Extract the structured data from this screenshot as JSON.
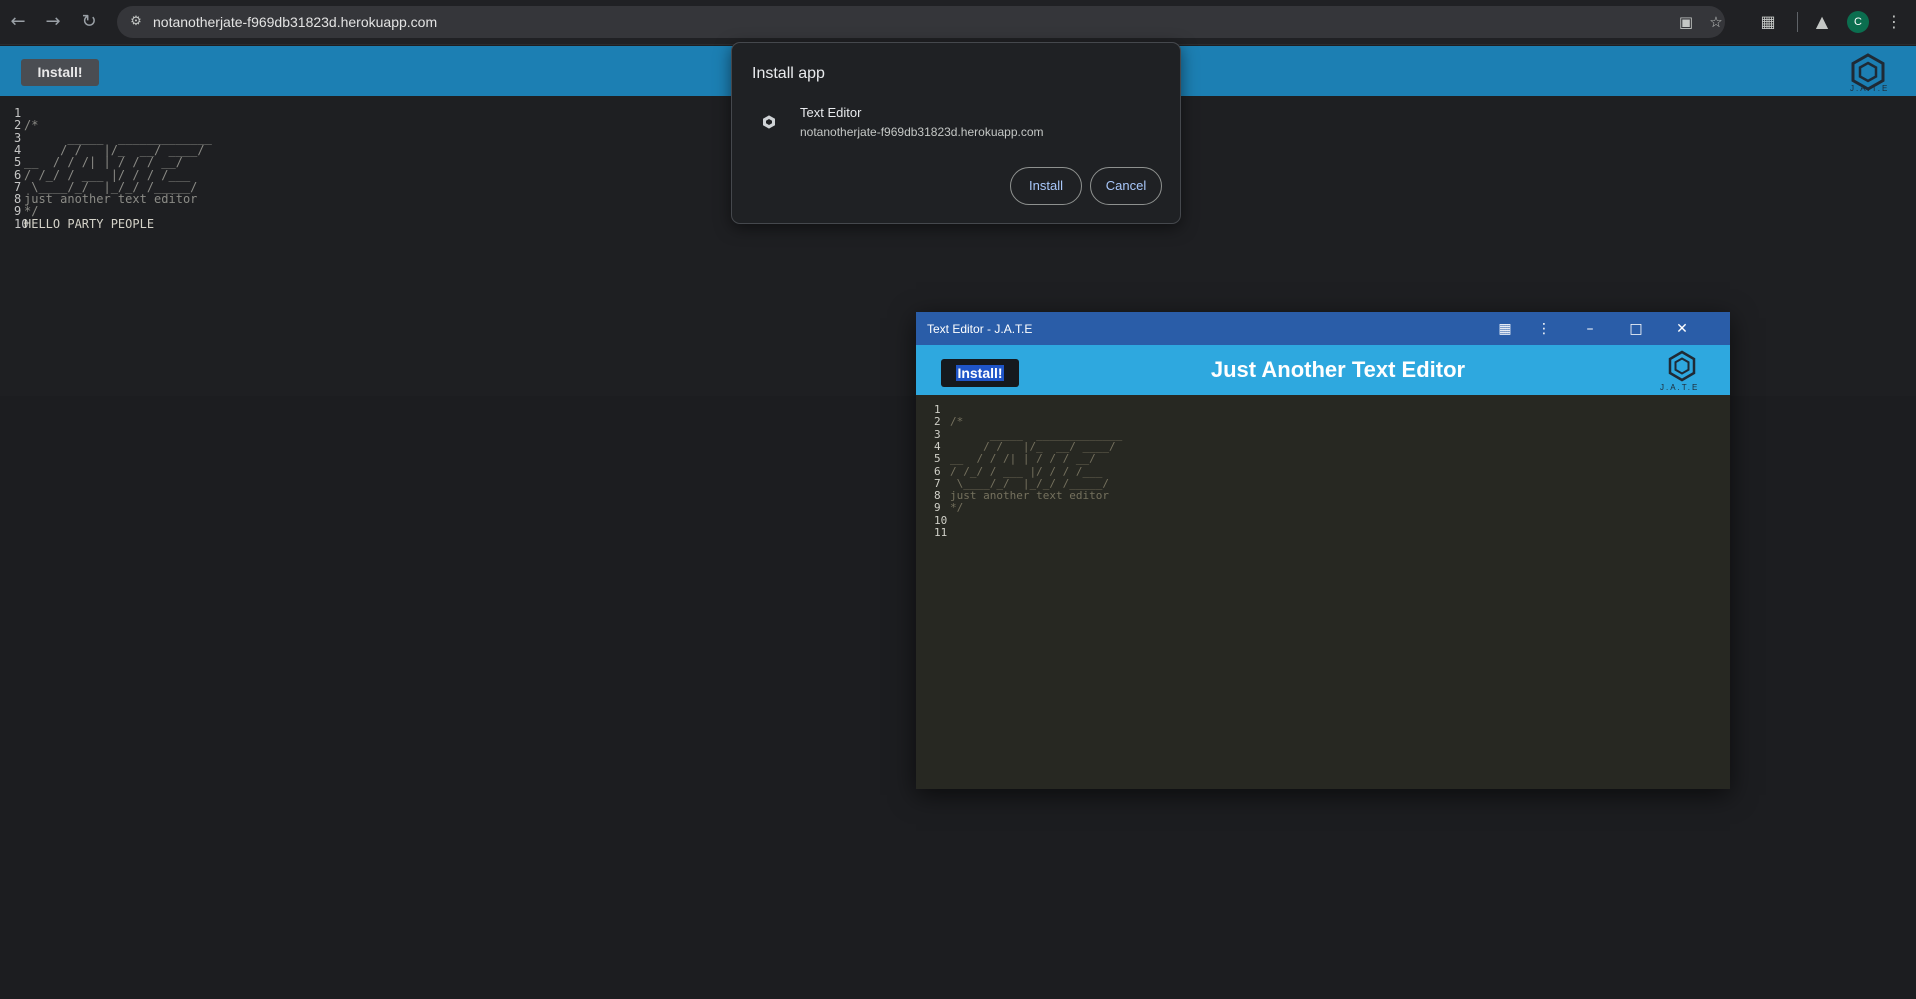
{
  "browser": {
    "url": "notanotherjate-f969db31823d.herokuapp.com",
    "profile_initial": "C",
    "icons": {
      "back": "back-arrow-icon",
      "forward": "forward-arrow-icon",
      "reload": "reload-icon",
      "site_info": "tune-icon",
      "install_app": "install-desktop-icon",
      "bookmark": "star-icon",
      "extensions": "puzzle-icon",
      "labs": "flask-icon",
      "menu": "kebab-menu-icon"
    }
  },
  "page": {
    "install_label": "Install!",
    "logo_text": "J.A.T.E",
    "header_color": "#1c7fb3",
    "editor_lines": [
      {
        "n": "1",
        "text": ""
      },
      {
        "n": "2",
        "text": "/*"
      },
      {
        "n": "3",
        "text": "      _____  _____________"
      },
      {
        "n": "4",
        "text": "     / /   |/_  __/ ____/"
      },
      {
        "n": "5",
        "text": "__  / / /| | / / / __/"
      },
      {
        "n": "6",
        "text": "/ /_/ / ___ |/ / / /___"
      },
      {
        "n": "7",
        "text": " \\____/_/  |_/_/ /_____/"
      },
      {
        "n": "8",
        "text": "just another text editor"
      },
      {
        "n": "9",
        "text": "*/"
      },
      {
        "n": "10",
        "text": "HELLO PARTY PEOPLE"
      }
    ]
  },
  "dialog": {
    "title": "Install app",
    "app_name": "Text Editor",
    "app_url": "notanotherjate-f969db31823d.herokuapp.com",
    "install_label": "Install",
    "cancel_label": "Cancel"
  },
  "pwa_window": {
    "title": "Text Editor - J.A.T.E",
    "heading": "Just Another Text Editor",
    "install_label": "Install!",
    "logo_text": "J.A.T.E",
    "header_color": "#2ea8df",
    "titlebar_color": "#2a5da8",
    "editor_lines": [
      {
        "n": "1",
        "text": ""
      },
      {
        "n": "2",
        "text": "/*"
      },
      {
        "n": "3",
        "text": "      _____  _____________"
      },
      {
        "n": "4",
        "text": "     / /   |/_  __/ ____/"
      },
      {
        "n": "5",
        "text": "__  / / /| | / / / __/"
      },
      {
        "n": "6",
        "text": "/ /_/ / ___ |/ / / /___"
      },
      {
        "n": "7",
        "text": " \\____/_/  |_/_/ /_____/"
      },
      {
        "n": "8",
        "text": "just another text editor"
      },
      {
        "n": "9",
        "text": "*/"
      },
      {
        "n": "10",
        "text": ""
      },
      {
        "n": "11",
        "text": ""
      }
    ]
  }
}
